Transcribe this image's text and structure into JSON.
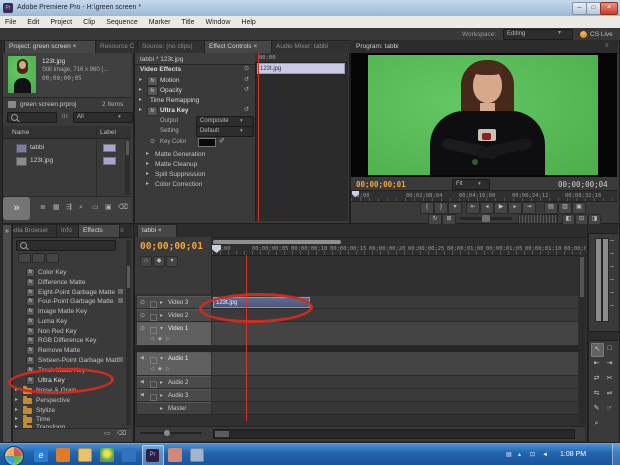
{
  "title_bar": {
    "app_title": "Adobe Premiere Pro - H:\\green screen *"
  },
  "menu_bar": {
    "items": [
      "File",
      "Edit",
      "Project",
      "Clip",
      "Sequence",
      "Marker",
      "Title",
      "Window",
      "Help"
    ]
  },
  "workspace_bar": {
    "label": "Workspace:",
    "value": "Editing",
    "cs_live": "CS Live"
  },
  "project_panel": {
    "tab": "Project: green screen",
    "tab_close": "×",
    "tab2": "Resource Central",
    "preview_name": "123t.jpg",
    "preview_info": "Still Image, 716 x 960 (...",
    "preview_duration": "00;00;00;05",
    "bin_name": "green screen.prproj",
    "count": "2 Items",
    "in_label": "In:",
    "in_value": "All",
    "col_name": "Name",
    "col_label": "Label",
    "items": [
      "tabbi",
      "123t.jpg"
    ]
  },
  "effect_controls": {
    "tab_source": "Source: (no clips)",
    "tab": "Effect Controls",
    "tab_close": "×",
    "tab_mixer": "Audio Mixer: tabbi",
    "header": "tabbi * 123t.jpg",
    "mini_time": "00;00",
    "clip": "123t.jpg",
    "video_effects": "Video Effects",
    "motion": "Motion",
    "opacity": "Opacity",
    "time_remapping": "Time Remapping",
    "ultra_key": "Ultra Key",
    "output_label": "Output",
    "output_value": "Composite",
    "setting_label": "Setting",
    "setting_value": "Default",
    "key_color": "Key Color",
    "groups": [
      "Matte Generation",
      "Matte Cleanup",
      "Spill Suppression",
      "Color Correction"
    ]
  },
  "program": {
    "tab": "Program: tabbi",
    "time": "00;00;00;01",
    "fit": "Fit",
    "out": "00;00;00;04",
    "ruler": [
      "00;00",
      "00;02;08;04",
      "00;04;16;08",
      "00;06;24;12",
      "00;08;32;16"
    ]
  },
  "effects_panel": {
    "tab_media": "Media Browser",
    "tab_info": "Info",
    "tab_effects": "Effects",
    "items": [
      "Color Key",
      "Difference Matte",
      "Eight-Point Garbage Matte",
      "Four-Point Garbage Matte",
      "Image Matte Key",
      "Luma Key",
      "Non Red Key",
      "RGB Difference Key",
      "Remove Matte",
      "Sixteen-Point Garbage Matte",
      "Track Matte Key",
      "Ultra Key"
    ],
    "folders": [
      "Noise & Grain",
      "Perspective",
      "Stylize",
      "Time",
      "Transform"
    ]
  },
  "timeline": {
    "tab": "tabbi",
    "tab_close": "×",
    "time": "00;00;00;01",
    "ruler": [
      "00;00",
      "00;00;00;05",
      "00;00;00;10",
      "00;00;00;15",
      "00;00;00;20",
      "00;00;00;25",
      "00;00;01;00",
      "00;00;01;05",
      "00;00;01;10",
      "00;00;01;15"
    ],
    "tracks_video": [
      "Video 3",
      "Video 2",
      "Video 1"
    ],
    "tracks_audio": [
      "Audio 1",
      "Audio 2",
      "Audio 3"
    ],
    "master": "Master",
    "clip": "123t.jpg"
  },
  "taskbar": {
    "clock": "1:08 PM"
  },
  "colors": {
    "timecode_orange": "#f0a63c",
    "annotation_red": "#cf2b1f",
    "green_screen": "#52bb52",
    "clip_blue": "#56628a",
    "taskbar_blue": "#2b6cb5"
  },
  "icons": {
    "min": "─",
    "max": "□",
    "close": "×",
    "panel_menu": "≡",
    "dd": "▾",
    "tri": "▸",
    "reset": "↺",
    "fx": "fx",
    "stopwatch": "⊙",
    "eyedropper": "✐",
    "eye": "⊙",
    "speaker": "◀",
    "kf_prev": "◁",
    "kf": "◆",
    "kf_next": "▷",
    "snap": "∩",
    "marker": "▾",
    "pencil": "✎",
    "mark_in": "{",
    "mark_out": "}",
    "go_in": "⇤",
    "step_back": "◂",
    "play": "▶",
    "step_fwd": "▸",
    "go_out": "⇥",
    "lift": "▤",
    "extract": "▥",
    "export": "▣",
    "loop": "↻",
    "safe": "⊞",
    "trim_l": "◧",
    "trim_c": "⊟",
    "trim_r": "◨",
    "chevrons": "»",
    "pr": "Pr",
    "e": "e",
    "tools": [
      "↖",
      "□",
      "⇤",
      "⇥",
      "⇄",
      "✂",
      "⇆",
      "⇌",
      "✎",
      "☞",
      "⌕"
    ],
    "tray": [
      "▤",
      "▴",
      "⊡",
      "◄"
    ],
    "list_icons": [
      "≣",
      "▦",
      "⇶",
      "⌕",
      "▭",
      "▣",
      "⌫"
    ]
  }
}
